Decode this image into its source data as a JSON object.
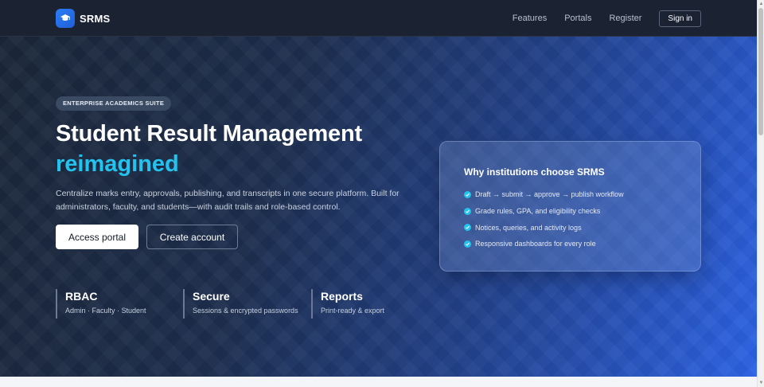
{
  "nav": {
    "brand": "SRMS",
    "links": [
      "Features",
      "Portals",
      "Register"
    ],
    "signin": "Sign in"
  },
  "hero": {
    "eyebrow": "ENTERPRISE ACADEMICS SUITE",
    "headline": "Student Result Management",
    "headline_accent": "reimagined",
    "subtext": "Centralize marks entry, approvals, publishing, and transcripts in one secure platform. Built for administrators, faculty, and students—with audit trails and role-based control.",
    "primary_button": "Access portal",
    "secondary_button": "Create account",
    "stats": [
      {
        "title": "RBAC",
        "sub": "Admin · Faculty · Student"
      },
      {
        "title": "Secure",
        "sub": "Sessions & encrypted passwords"
      },
      {
        "title": "Reports",
        "sub": "Print-ready & export"
      }
    ]
  },
  "card": {
    "title": "Why institutions choose SRMS",
    "items": [
      "Draft → submit → approve → publish workflow",
      "Grade rules, GPA, and eligibility checks",
      "Notices, queries, and activity logs",
      "Responsive dashboards for every role"
    ]
  },
  "colors": {
    "accent": "#22c3ee",
    "brand": "#2d7df6",
    "nav_bg": "#1b2232"
  },
  "icons": {
    "brand": "graduation-cap-icon",
    "check": "check-circle-icon"
  }
}
